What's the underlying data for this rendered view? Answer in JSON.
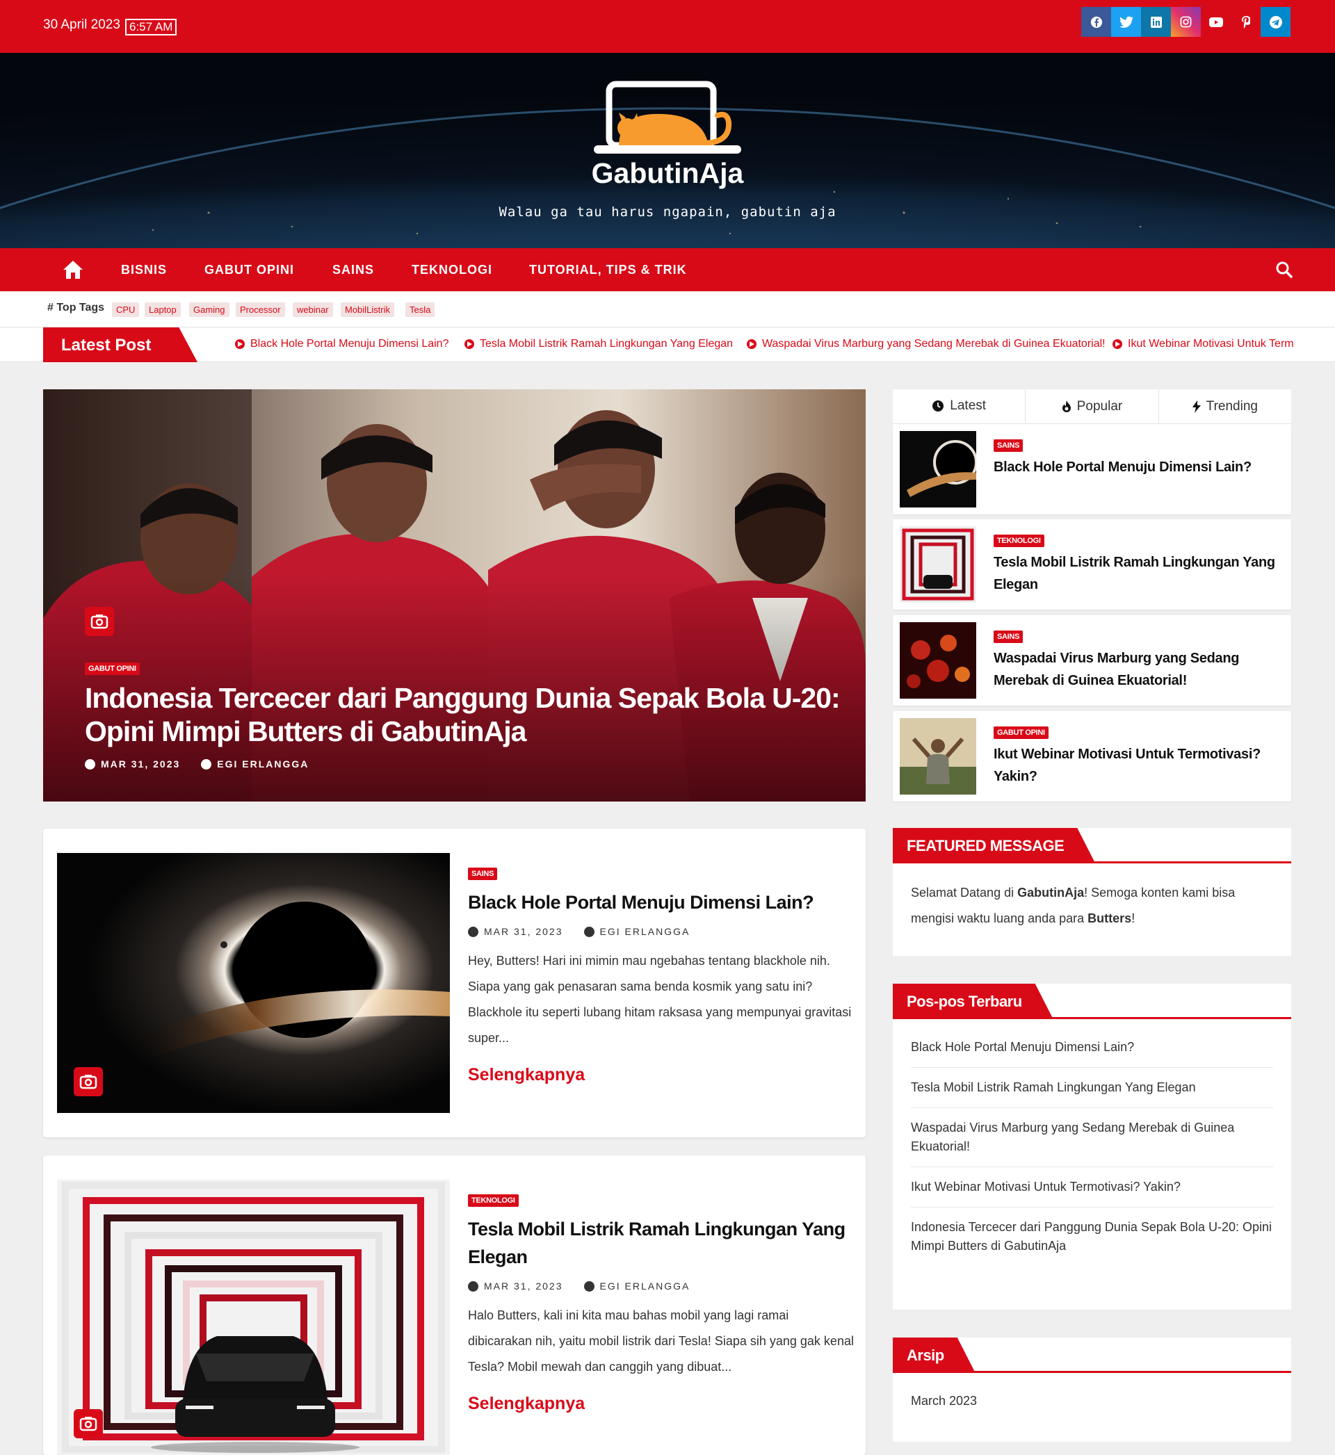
{
  "topbar": {
    "date": "30 April 2023",
    "time": "6:57 AM",
    "social": [
      {
        "icon": "facebook-icon",
        "glyph": "f",
        "color": "#3b5998"
      },
      {
        "icon": "twitter-icon",
        "glyph": "t",
        "color": "#1da1f2"
      },
      {
        "icon": "linkedin-icon",
        "glyph": "in",
        "color": "#0e76a8"
      },
      {
        "icon": "instagram-icon",
        "glyph": "◎",
        "color": "#e1306c"
      },
      {
        "icon": "youtube-icon",
        "glyph": "▶",
        "color": "#d90a18"
      },
      {
        "icon": "pinterest-icon",
        "glyph": "P",
        "color": "#d90a18"
      },
      {
        "icon": "telegram-icon",
        "glyph": "➤",
        "color": "#0088cc"
      }
    ]
  },
  "header": {
    "site_title": "GabutinAja",
    "tagline": "Walau ga tau harus ngapain, gabutin aja"
  },
  "nav": {
    "items": [
      "BISNIS",
      "GABUT OPINI",
      "SAINS",
      "TEKNOLOGI",
      "TUTORIAL, TIPS & TRIK"
    ]
  },
  "tags": {
    "heading": "Top Tags",
    "items": [
      "CPU",
      "Laptop",
      "Gaming",
      "Processor",
      "webinar",
      "MobilListrik",
      "Tesla"
    ]
  },
  "ticker": {
    "label": "Latest Post",
    "items": [
      "Black Hole Portal Menuju Dimensi Lain?",
      "Tesla Mobil Listrik Ramah Lingkungan Yang Elegan",
      "Waspadai Virus Marburg yang Sedang Merebak di Guinea Ekuatorial!",
      "Ikut Webinar Motivasi Untuk Term"
    ]
  },
  "featured": {
    "category": "GABUT OPINI",
    "title": "Indonesia Tercecer dari Panggung Dunia Sepak Bola U-20: Opini Mimpi Butters di GabutinAja",
    "date": "MAR 31, 2023",
    "author": "EGI ERLANGGA"
  },
  "posts": [
    {
      "category": "SAINS",
      "title": "Black Hole Portal Menuju Dimensi Lain?",
      "date": "MAR 31, 2023",
      "author": "EGI ERLANGGA",
      "excerpt": "Hey, Butters! Hari ini mimin mau ngebahas tentang blackhole nih. Siapa yang gak penasaran sama benda kosmik yang satu ini? Blackhole itu seperti lubang hitam raksasa yang mempunyai gravitasi super...",
      "more": "Selengkapnya"
    },
    {
      "category": "TEKNOLOGI",
      "title": "Tesla Mobil Listrik Ramah Lingkungan Yang Elegan",
      "date": "MAR 31, 2023",
      "author": "EGI ERLANGGA",
      "excerpt": "Halo Butters, kali ini kita mau bahas mobil yang lagi ramai dibicarakan nih, yaitu mobil listrik dari Tesla! Siapa sih yang gak kenal Tesla? Mobil mewah dan canggih yang dibuat...",
      "more": "Selengkapnya"
    }
  ],
  "sidebar": {
    "tabs": [
      "Latest",
      "Popular",
      "Trending"
    ],
    "items": [
      {
        "category": "SAINS",
        "title": "Black Hole Portal Menuju Dimensi Lain?"
      },
      {
        "category": "TEKNOLOGI",
        "title": "Tesla Mobil Listrik Ramah Lingkungan Yang Elegan"
      },
      {
        "category": "SAINS",
        "title": "Waspadai Virus Marburg yang Sedang Merebak di Guinea Ekuatorial!"
      },
      {
        "category": "GABUT OPINI",
        "title": "Ikut Webinar Motivasi Untuk Termotivasi? Yakin?"
      }
    ],
    "featured_message": {
      "heading": "FEATURED MESSAGE",
      "text_1": "Selamat Datang  di ",
      "brand": "GabutinAja",
      "text_2": "! Semoga konten kami bisa mengisi waktu luang anda para ",
      "who": "Butters",
      "text_3": "!"
    },
    "recent": {
      "heading": "Pos-pos Terbaru",
      "items": [
        "Black Hole Portal Menuju Dimensi Lain?",
        "Tesla Mobil Listrik Ramah Lingkungan Yang Elegan",
        "Waspadai Virus Marburg yang Sedang Merebak di Guinea Ekuatorial!",
        "Ikut Webinar Motivasi Untuk Termotivasi? Yakin?",
        "Indonesia Tercecer dari Panggung Dunia Sepak Bola U-20: Opini Mimpi Butters di GabutinAja"
      ]
    },
    "archive": {
      "heading": "Arsip",
      "items": [
        "March 2023"
      ]
    }
  }
}
